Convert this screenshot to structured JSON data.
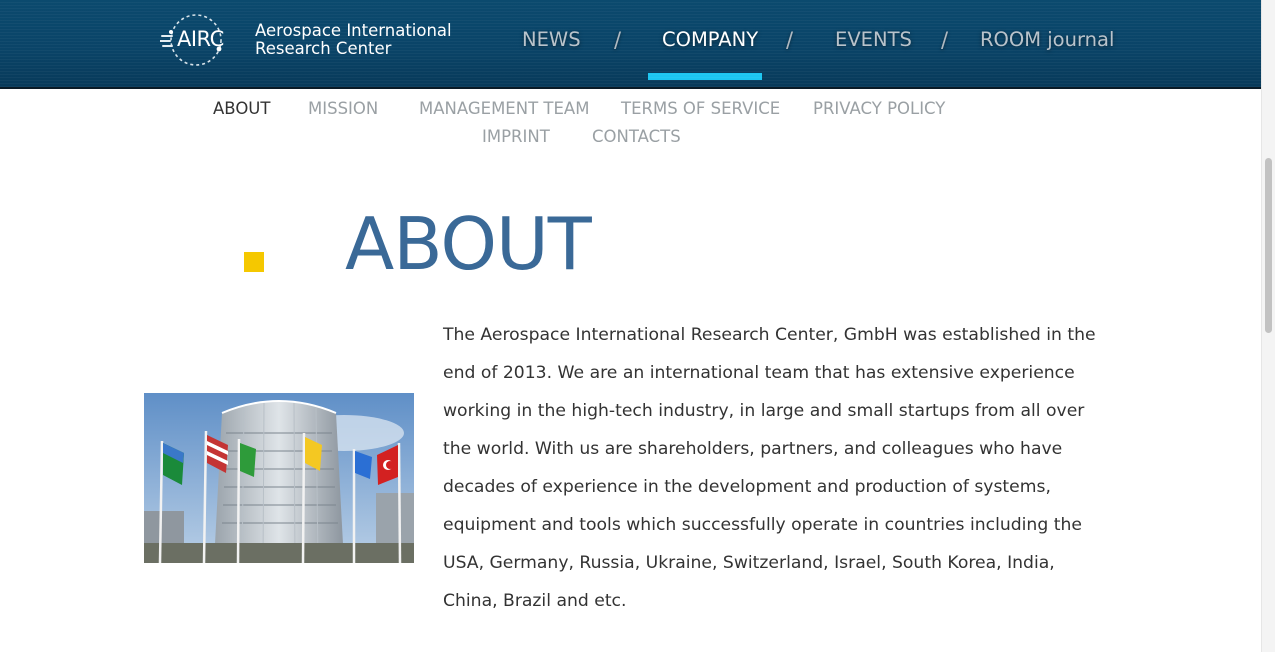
{
  "header": {
    "logo": {
      "abbr": "AIRC",
      "line1": "Aerospace International",
      "line2": "Research Center"
    },
    "nav": [
      {
        "label": "NEWS",
        "active": false
      },
      {
        "label": "COMPANY",
        "active": true
      },
      {
        "label": "EVENTS",
        "active": false
      },
      {
        "label": "ROOM journal",
        "active": false
      }
    ],
    "separator": "/",
    "active_indicator_color": "#1cc6f2"
  },
  "subnav": [
    {
      "label": "ABOUT",
      "active": true
    },
    {
      "label": "MISSION",
      "active": false
    },
    {
      "label": "MANAGEMENT TEAM",
      "active": false
    },
    {
      "label": "TERMS OF SERVICE",
      "active": false
    },
    {
      "label": "PRIVACY POLICY",
      "active": false
    },
    {
      "label": "IMPRINT",
      "active": false
    },
    {
      "label": "CONTACTS",
      "active": false
    }
  ],
  "main": {
    "title": "ABOUT",
    "image": {
      "icon": "un-building-flags-photo"
    },
    "text": "The Aerospace International Research Center, GmbH was established in the end of 2013. We are an international team that has extensive experience working in the high-tech industry, in large and small startups from all over the world. With us are shareholders, partners, and colleagues who have decades of experience in the development and production of systems, equipment and tools which successfully operate in countries including the USA, Germany, Russia, Ukraine, Switzerland, Israel, South Korea, India, China, Brazil and etc."
  },
  "colors": {
    "header_bg": "#0a4468",
    "accent_cyan": "#1cc6f2",
    "accent_yellow": "#f5c800",
    "title_blue": "#3a6997",
    "body_text": "#333333",
    "subnav_inactive": "#9aa0a4"
  }
}
